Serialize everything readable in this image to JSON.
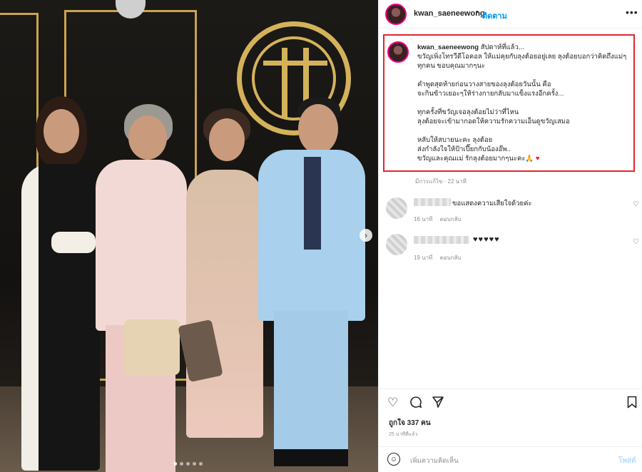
{
  "header": {
    "username": "kwan_saeneewong",
    "separator": "•",
    "follow_label": "ติดตาม",
    "more_icon": "more-horizontal-icon"
  },
  "caption": {
    "username": "kwan_saeneewong",
    "time": "สัปดาห์ที่แล้ว...",
    "lines": [
      "ขวัญเพิ่งโทรวีดีโอคอล ให้แม่คุยกับลุงต้อยอยู่เลย ลุงต้อยบอกว่าคิดถึงแม่ๆทุกคน ขอบคุณมากๆนะ",
      "",
      "คำพูดสุดท้ายก่อนวางสายของลุงต้อยวันนั้น คือ",
      "จะกินข้าวเยอะๆให้ร่างกายกลับมาแข็งแรงอีกครั้ง...",
      "",
      "ทุกครั้งที่ขวัญเจอลุงต้อยไม่ว่าที่ไหน",
      "ลุงต้อยจะเข้ามากอดให้ความรักความเอ็นดูขวัญเสมอ",
      "",
      "หลับให้สบายนะคะ ลุงต้อย",
      "ส่งกำลังใจให้ป้าเปี๊ยกกับน้องอ๊พ..",
      "ขวัญและคุณแม่ รักลุงต้อยมากๆนะคะ🙏"
    ],
    "heart": "♥",
    "meta": "มีการแก้ไข · 22 นาที"
  },
  "comments": [
    {
      "text": "ขอแสดงความเสียใจด้วยค่ะ",
      "time": "16 นาที",
      "reply": "ตอบกลับ"
    },
    {
      "text": "♥♥♥♥♥",
      "time": "19 นาที",
      "reply": "ตอบกลับ"
    }
  ],
  "actions": {
    "like_icon": "heart-outline-icon",
    "comment_icon": "comment-icon",
    "share_icon": "send-icon",
    "save_icon": "bookmark-icon"
  },
  "likes": "ถูกใจ 337 คน",
  "posted_ago": "25 นาทีที่แล้ว",
  "add_comment": {
    "placeholder": "เพิ่มความคิดเห็น",
    "post_label": "โพสต์"
  },
  "carousel": {
    "slides": 5,
    "active_index": 1
  },
  "colors": {
    "accent": "#0095f6",
    "highlight_box": "#e0252b",
    "heart": "#ed1c24",
    "photo_gold": "#c9a44e"
  }
}
